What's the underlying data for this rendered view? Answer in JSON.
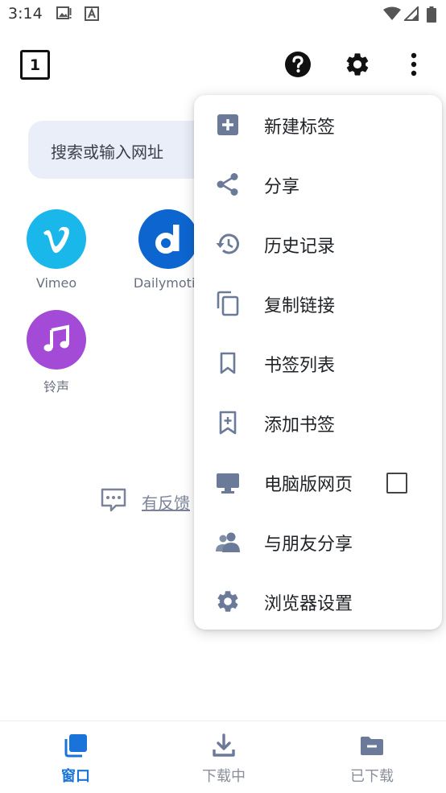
{
  "status_bar": {
    "time": "3:14",
    "icons": [
      "image-alert-icon",
      "font-icon",
      "wifi-icon",
      "signal-icon",
      "battery-icon"
    ]
  },
  "toolbar": {
    "tab_count": "1",
    "icons": [
      "help-icon",
      "settings-icon",
      "more-vert-icon"
    ]
  },
  "home": {
    "search_placeholder": "搜索或输入网址",
    "shortcuts": [
      {
        "label": "Vimeo",
        "icon": "vimeo-logo",
        "color": "#1ab7ea"
      },
      {
        "label": "Dailymotio",
        "icon": "dailymotion-logo",
        "color": "#0d66d0"
      },
      {
        "label": "铃声",
        "icon": "music-note-icon",
        "color": "#a34bd6"
      }
    ],
    "feedback_label": "有反馈"
  },
  "menu": {
    "items": [
      {
        "label": "新建标签",
        "icon": "add-box-icon"
      },
      {
        "label": "分享",
        "icon": "share-icon"
      },
      {
        "label": "历史记录",
        "icon": "history-icon"
      },
      {
        "label": "复制链接",
        "icon": "copy-icon"
      },
      {
        "label": "书签列表",
        "icon": "bookmark-icon"
      },
      {
        "label": "添加书签",
        "icon": "bookmark-add-icon"
      },
      {
        "label": "电脑版网页",
        "icon": "desktop-icon",
        "checkbox": false
      },
      {
        "label": "与朋友分享",
        "icon": "people-icon"
      },
      {
        "label": "浏览器设置",
        "icon": "gear-icon"
      }
    ]
  },
  "bottom_nav": {
    "items": [
      {
        "label": "窗口",
        "icon": "windows-icon",
        "active": true
      },
      {
        "label": "下载中",
        "icon": "download-icon",
        "active": false
      },
      {
        "label": "已下载",
        "icon": "folder-icon",
        "active": false
      }
    ]
  },
  "colors": {
    "accent": "#1a73d9",
    "menu_icon": "#6b7a99",
    "search_bg": "#eaeef8"
  }
}
